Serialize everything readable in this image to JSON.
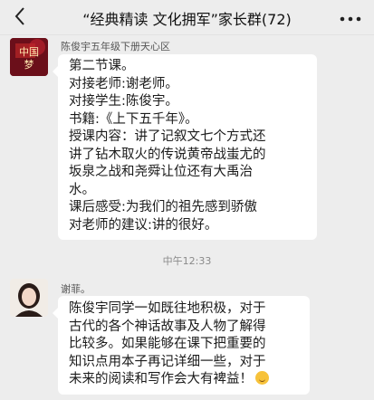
{
  "header": {
    "back_icon": "chevron-left-icon",
    "title": "“经典精读 文化拥军”家长群(72)",
    "more_icon": "more-icon"
  },
  "messages": [
    {
      "sender": "陈俊宇五年级下册天心区",
      "avatar_text": "中国梦",
      "lines": [
        "第二节课。",
        "对接老师:谢老师。",
        "对接学生:陈俊宇。",
        "书籍:《上下五千年》。",
        "授课内容：讲了记叙文七个方式还",
        "讲了钻木取火的传说黄帝战蚩尤的",
        "坂泉之战和尧舜让位还有大禹治",
        "水。",
        "课后感受:为我们的祖先感到骄傲",
        "对老师的建议:讲的很好。"
      ]
    },
    {
      "sender": "谢菲。",
      "lines": [
        "陈俊宇同学一如既往地积极，对于",
        "古代的各个神话故事及人物了解得",
        "比较多。如果能够在课下把重要的",
        "知识点用本子再记详细一些，对于",
        "未来的阅读和写作会大有裨益！"
      ],
      "emoji_icon": "smile-emoji-icon"
    }
  ],
  "timestamp": "中午12:33"
}
